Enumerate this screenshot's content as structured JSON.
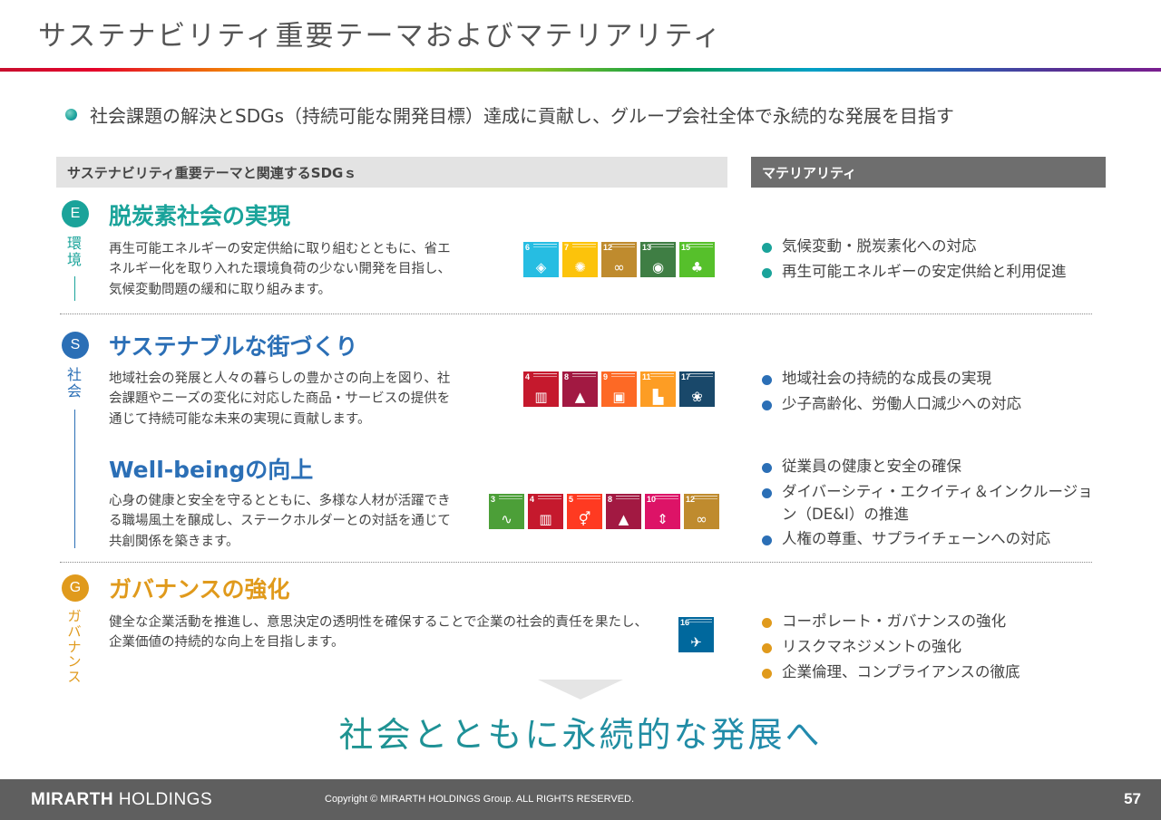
{
  "title": "サステナビリティ重要テーマおよびマテリアリティ",
  "lead": "社会課題の解決とSDGs（持続可能な開発目標）達成に貢献し、グループ会社全体で永続的な発展を目指す",
  "headers": {
    "left": "サステナビリティ重要テーマと関連するSDGｓ",
    "right": "マテリアリティ"
  },
  "colors": {
    "env": "#1aa39a",
    "social": "#2b6fb6",
    "gov": "#e09a1c"
  },
  "sections": {
    "env": {
      "badge": "E",
      "label": "環境",
      "themes": [
        {
          "title": "脱炭素社会の実現",
          "desc": "再生可能エネルギーの安定供給に取り組むとともに、省エネルギー化を取り入れた環境負荷の少ない開発を目指し、気候変動問題の緩和に取り組みます。",
          "sdgs": [
            {
              "num": "6",
              "icon": "water-drop-icon",
              "glyph": "◈",
              "color": "#26bde2"
            },
            {
              "num": "7",
              "icon": "sun-icon",
              "glyph": "✺",
              "color": "#fcc30b"
            },
            {
              "num": "12",
              "icon": "infinity-icon",
              "glyph": "∞",
              "color": "#bf8b2e"
            },
            {
              "num": "13",
              "icon": "eye-globe-icon",
              "glyph": "◉",
              "color": "#3f7e44"
            },
            {
              "num": "15",
              "icon": "tree-icon",
              "glyph": "♣",
              "color": "#56c02b"
            }
          ],
          "materiality": [
            "気候変動・脱炭素化への対応",
            "再生可能エネルギーの安定供給と利用促進"
          ]
        }
      ]
    },
    "social": {
      "badge": "S",
      "label": "社会",
      "themes": [
        {
          "title": "サステナブルな街づくり",
          "desc": "地域社会の発展と人々の暮らしの豊かさの向上を図り、社会課題やニーズの変化に対応した商品・サービスの提供を通じて持続可能な未来の実現に貢献します。",
          "sdgs": [
            {
              "num": "4",
              "icon": "book-icon",
              "glyph": "▥",
              "color": "#c5192d"
            },
            {
              "num": "8",
              "icon": "growth-chart-icon",
              "glyph": "▲",
              "color": "#a21942"
            },
            {
              "num": "9",
              "icon": "cubes-icon",
              "glyph": "▣",
              "color": "#fd6925"
            },
            {
              "num": "11",
              "icon": "city-icon",
              "glyph": "▙",
              "color": "#fd9d24"
            },
            {
              "num": "17",
              "icon": "flower-ring-icon",
              "glyph": "❀",
              "color": "#19486a"
            }
          ],
          "materiality": [
            "地域社会の持続的な成長の実現",
            "少子高齢化、労働人口減少への対応"
          ]
        },
        {
          "title": "Well-beingの向上",
          "desc": "心身の健康と安全を守るとともに、多様な人材が活躍できる職場風土を醸成し、ステークホルダーとの対話を通じて共創関係を築きます。",
          "sdgs": [
            {
              "num": "3",
              "icon": "heartbeat-icon",
              "glyph": "∿",
              "color": "#4c9f38"
            },
            {
              "num": "4",
              "icon": "book-icon",
              "glyph": "▥",
              "color": "#c5192d"
            },
            {
              "num": "5",
              "icon": "gender-icon",
              "glyph": "⚥",
              "color": "#ff3a21"
            },
            {
              "num": "8",
              "icon": "growth-chart-icon",
              "glyph": "▲",
              "color": "#a21942"
            },
            {
              "num": "10",
              "icon": "equality-icon",
              "glyph": "⇕",
              "color": "#dd1367"
            },
            {
              "num": "12",
              "icon": "infinity-icon",
              "glyph": "∞",
              "color": "#bf8b2e"
            }
          ],
          "materiality": [
            "従業員の健康と安全の確保",
            "ダイバーシティ・エクイティ＆インクルージョン（DE&I）の推進",
            "人権の尊重、サプライチェーンへの対応"
          ]
        }
      ]
    },
    "gov": {
      "badge": "G",
      "label": "ガバナンス",
      "themes": [
        {
          "title": "ガバナンスの強化",
          "desc": "健全な企業活動を推進し、意思決定の透明性を確保することで企業の社会的責任を果たし、企業価値の持続的な向上を目指します。",
          "sdgs": [
            {
              "num": "16",
              "icon": "dove-gavel-icon",
              "glyph": "✈",
              "color": "#00689d"
            }
          ],
          "materiality": [
            "コーポレート・ガバナンスの強化",
            "リスクマネジメントの強化",
            "企業倫理、コンプライアンスの徹底"
          ]
        }
      ]
    }
  },
  "slogan": "社会とともに永続的な発展へ",
  "footer": {
    "brand_bold": "MIRARTH",
    "brand_rest": " HOLDINGS",
    "copyright": "Copyright © MIRARTH HOLDINGS Group. ALL RIGHTS RESERVED.",
    "page": "57"
  }
}
